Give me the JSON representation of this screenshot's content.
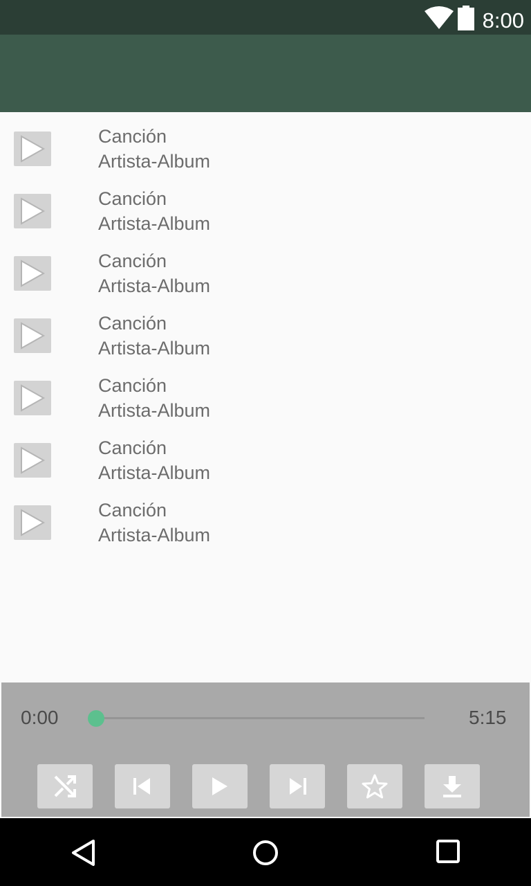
{
  "status_bar": {
    "time": "8:00",
    "icons": [
      "wifi-icon",
      "battery-icon"
    ]
  },
  "songs": [
    {
      "title": "Canción",
      "subtitle": "Artista-Album"
    },
    {
      "title": "Canción",
      "subtitle": "Artista-Album"
    },
    {
      "title": "Canción",
      "subtitle": "Artista-Album"
    },
    {
      "title": "Canción",
      "subtitle": "Artista-Album"
    },
    {
      "title": "Canción",
      "subtitle": "Artista-Album"
    },
    {
      "title": "Canción",
      "subtitle": "Artista-Album"
    },
    {
      "title": "Canción",
      "subtitle": "Artista-Album"
    }
  ],
  "player": {
    "current_time": "0:00",
    "total_time": "5:15",
    "progress": 0,
    "controls": [
      "shuffle-icon",
      "skip-previous-icon",
      "play-icon",
      "skip-next-icon",
      "star-icon",
      "download-icon"
    ]
  },
  "nav_bar": {
    "buttons": [
      "back-icon",
      "home-icon",
      "recents-icon"
    ]
  },
  "colors": {
    "status_bar": "#2b3e35",
    "app_bar": "#3d5b4c",
    "accent": "#5cc08e",
    "player_bg": "#a9a9a9"
  }
}
